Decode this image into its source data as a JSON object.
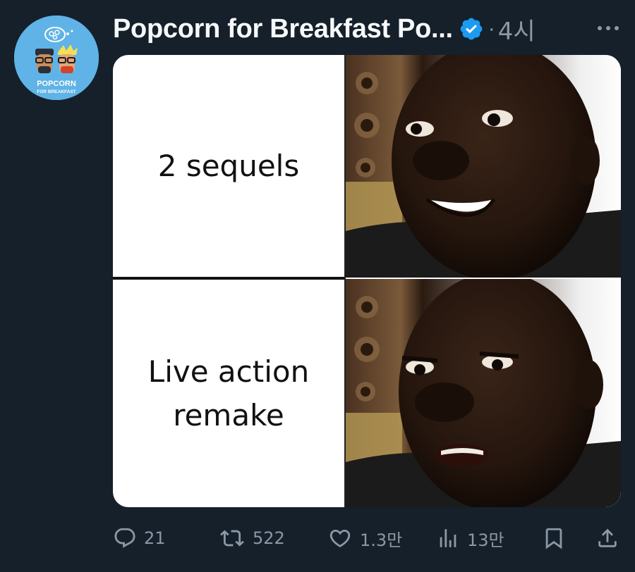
{
  "tweet": {
    "display_name": "Popcorn for Breakfast Po...",
    "separator": "·",
    "time": "4시",
    "avatar_text_main": "POPCORN",
    "avatar_text_sub": "FOR BREAKFAST",
    "more_icon": "more-dots-icon",
    "verified_icon": "verified-badge-icon"
  },
  "meme": {
    "top_text": "2 sequels",
    "bottom_text_line1": "Live action",
    "bottom_text_line2": "remake"
  },
  "actions": {
    "reply_count": "21",
    "retweet_count": "522",
    "like_count": "1.3만",
    "views_count": "13만"
  },
  "colors": {
    "background": "#15202b",
    "text_primary": "#f7f9f9",
    "text_secondary": "#8b98a5",
    "verified": "#1d9bf0",
    "avatar_bg": "#5fb3e6"
  }
}
